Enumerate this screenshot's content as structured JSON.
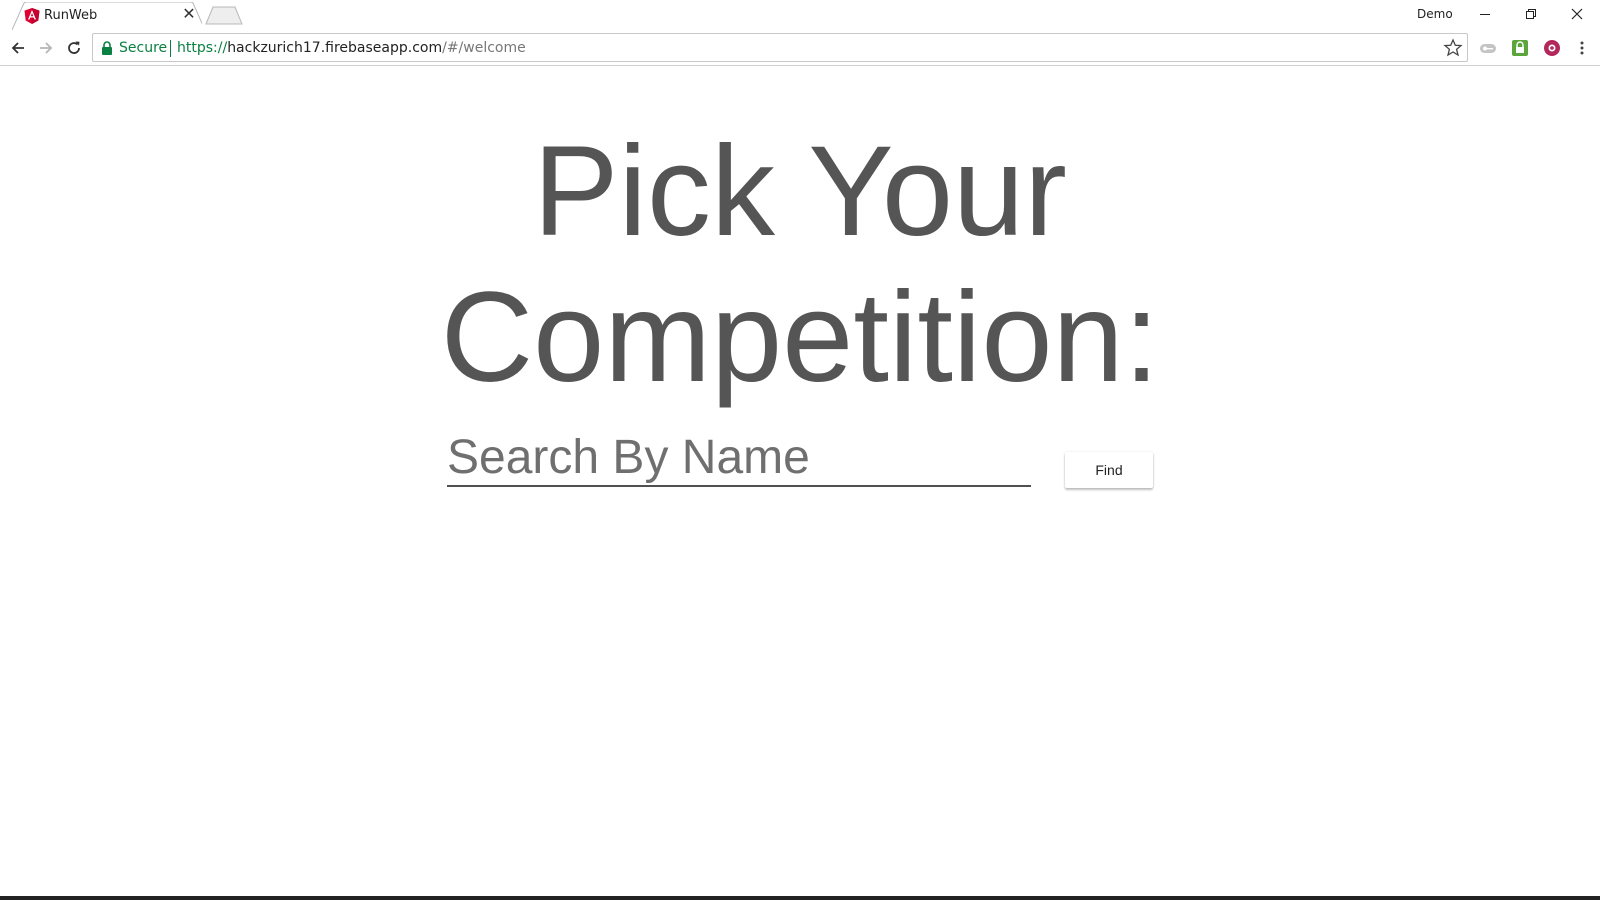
{
  "browser": {
    "tab_title": "RunWeb",
    "tab_close": "✕",
    "profile_name": "Demo",
    "security_label": "Secure",
    "url_scheme": "https://",
    "url_host": "hackzurich17.firebaseapp.com",
    "url_path": "/#/welcome"
  },
  "page": {
    "headline_line1": "Pick Your",
    "headline_line2": "Competition:",
    "search_placeholder": "Search By Name",
    "search_value": "",
    "find_label": "Find"
  },
  "colors": {
    "headline": "#555555",
    "secure_green": "#0b8043",
    "angular_red": "#dd0031"
  }
}
